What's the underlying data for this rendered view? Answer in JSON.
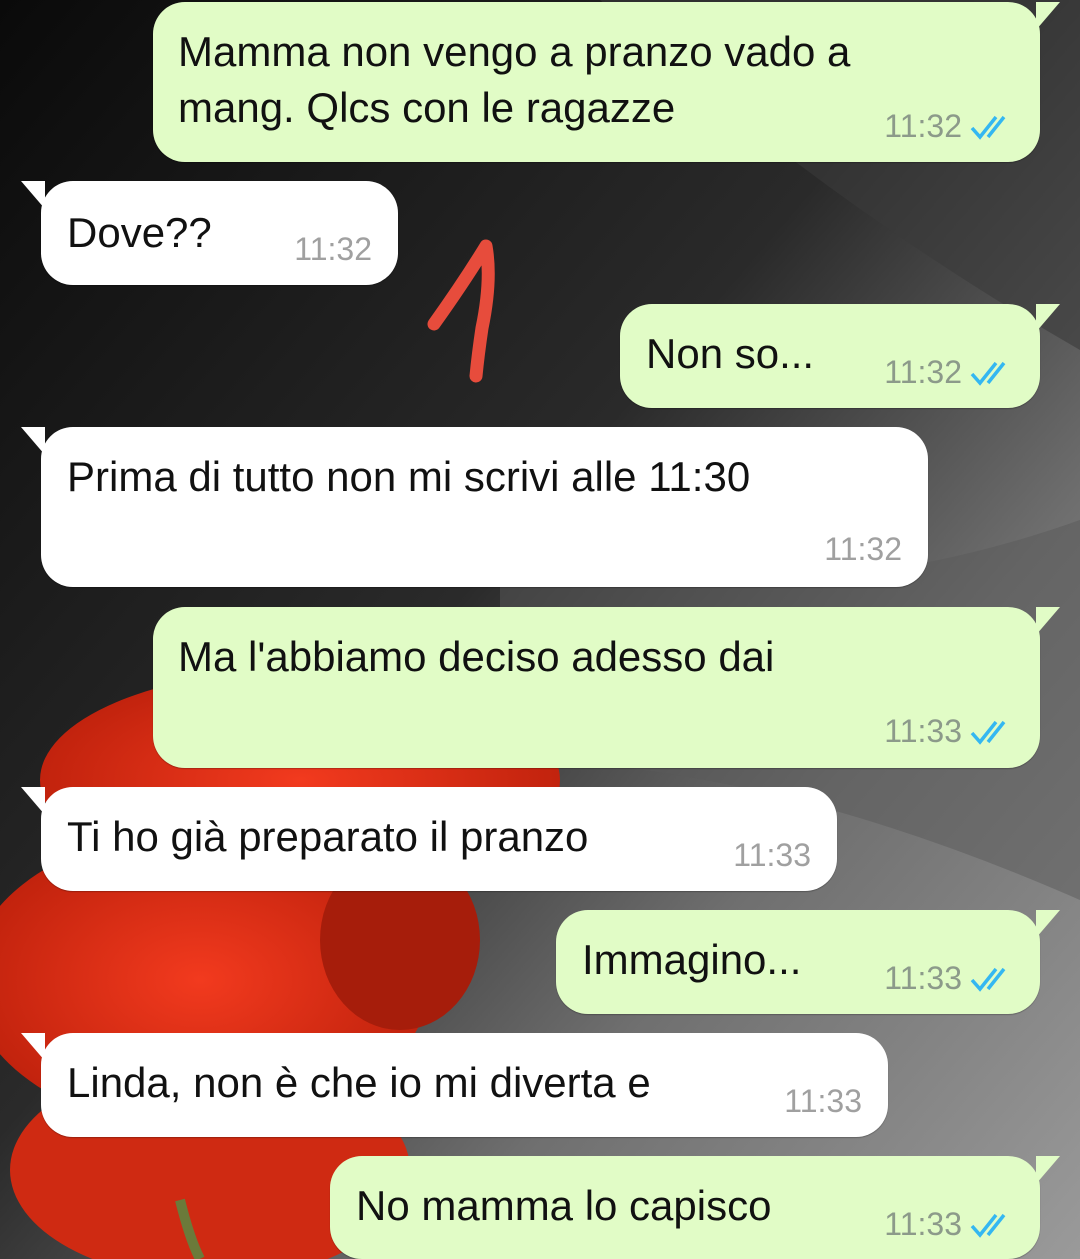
{
  "app": {
    "accent_colors": {
      "outgoing_bubble": "#e1fcc6",
      "incoming_bubble": "#ffffff",
      "read_tick": "#34b7f1",
      "annotation": "#e74c3c"
    }
  },
  "messages": [
    {
      "direction": "outgoing",
      "text": "Mamma non vengo a pranzo vado a\nmang. Qlcs con le ragazze",
      "time": "11:32",
      "status": "read-double-tick-icon"
    },
    {
      "direction": "incoming",
      "text": "Dove??",
      "time": "11:32"
    },
    {
      "direction": "outgoing",
      "text": "Non so...",
      "time": "11:32",
      "status": "read-double-tick-icon"
    },
    {
      "direction": "incoming",
      "text": "Prima di tutto non mi scrivi alle 11:30",
      "time": "11:32"
    },
    {
      "direction": "outgoing",
      "text": "Ma l'abbiamo deciso adesso dai",
      "time": "11:33",
      "status": "read-double-tick-icon"
    },
    {
      "direction": "incoming",
      "text": "Ti ho già preparato il pranzo",
      "time": "11:33"
    },
    {
      "direction": "outgoing",
      "text": "Immagino...",
      "time": "11:33",
      "status": "read-double-tick-icon"
    },
    {
      "direction": "incoming",
      "text": "Linda, non è che io mi diverta e",
      "time": "11:33"
    },
    {
      "direction": "outgoing",
      "text": "No mamma lo capisco",
      "time": "11:33",
      "status": "read-double-tick-icon"
    }
  ],
  "annotation": {
    "label": "1",
    "icon": "handwritten-number-annotation"
  },
  "wallpaper": {
    "icon": "red-poppy-wallpaper"
  }
}
